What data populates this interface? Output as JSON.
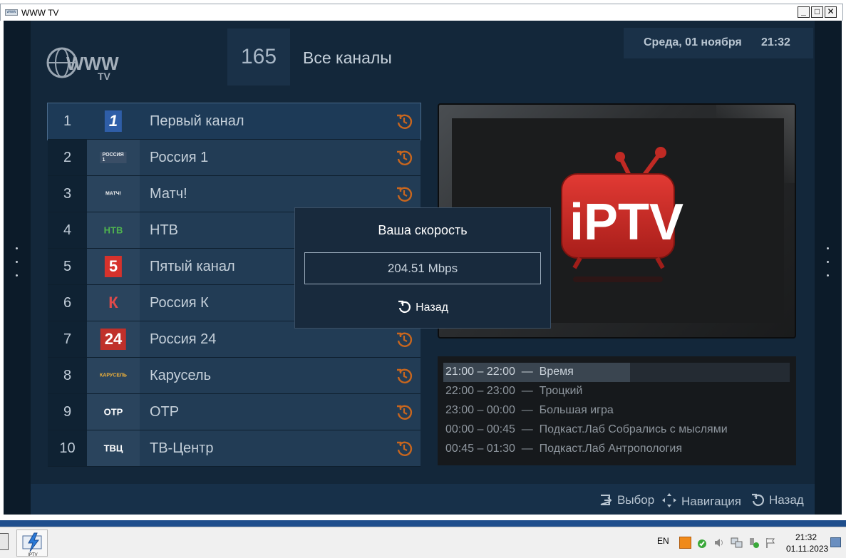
{
  "window": {
    "title": "WWW TV",
    "icon_label": "www",
    "min_label": "_",
    "max_label": "□",
    "close_label": "✕"
  },
  "logo": {
    "text": "WWW",
    "sub": "TV"
  },
  "header": {
    "channel_count": "165",
    "category": "Все каналы",
    "date": "Среда, 01 ноября",
    "time": "21:32"
  },
  "channels": [
    {
      "num": "1",
      "name": "Первый канал",
      "logo": "1",
      "logo_color": "#2f5ea8",
      "logo_fg": "#ffffff"
    },
    {
      "num": "2",
      "name": "Россия 1",
      "logo": "РОССИЯ 1",
      "logo_color": "#3a4e66",
      "logo_fg": "#e8ecf0"
    },
    {
      "num": "3",
      "name": "Матч!",
      "logo": "МАТЧ!",
      "logo_color": "#2a445d",
      "logo_fg": "#f0f0f0"
    },
    {
      "num": "4",
      "name": "НТВ",
      "logo": "НТВ",
      "logo_color": "#2a445d",
      "logo_fg": "#4fb34f"
    },
    {
      "num": "5",
      "name": "Пятый канал",
      "logo": "5",
      "logo_color": "#d6322c",
      "logo_fg": "#ffffff"
    },
    {
      "num": "6",
      "name": "Россия К",
      "logo": "К",
      "logo_color": "#2a445d",
      "logo_fg": "#e04a4a"
    },
    {
      "num": "7",
      "name": "Россия 24",
      "logo": "24",
      "logo_color": "#c0302a",
      "logo_fg": "#ffffff"
    },
    {
      "num": "8",
      "name": "Карусель",
      "logo": "КАРУСЕЛЬ",
      "logo_color": "#2a445d",
      "logo_fg": "#f0b23a"
    },
    {
      "num": "9",
      "name": "ОТР",
      "logo": "ОТР",
      "logo_color": "#2a445d",
      "logo_fg": "#ffffff"
    },
    {
      "num": "10",
      "name": "ТВ-Центр",
      "logo": "ТВЦ",
      "logo_color": "#2a445d",
      "logo_fg": "#ffffff"
    }
  ],
  "preview": {
    "logo_text": "iPTV"
  },
  "epg": [
    {
      "time": "21:00 – 22:00",
      "title": "Время",
      "current": true
    },
    {
      "time": "22:00 – 23:00",
      "title": "Троцкий",
      "current": false
    },
    {
      "time": "23:00 – 00:00",
      "title": "Большая игра",
      "current": false
    },
    {
      "time": "00:00 – 00:45",
      "title": "Подкаст.Лаб Собрались с мыслями",
      "current": false
    },
    {
      "time": "00:45 – 01:30",
      "title": "Подкаст.Лаб Антропология",
      "current": false
    }
  ],
  "epg_progress": 0.54,
  "dialog": {
    "title": "Ваша скорость",
    "value": "204.51 Mbps",
    "back_label": "Назад"
  },
  "bottom": {
    "select_label": "Выбор",
    "nav_label": "Навигация",
    "back_label": "Назад"
  },
  "taskbar": {
    "lang": "EN",
    "time": "21:32",
    "date": "01.11.2023",
    "app2_label": "IPTV"
  },
  "colors": {
    "history_icon": "#c8661e",
    "accent_red": "#c8302a"
  }
}
